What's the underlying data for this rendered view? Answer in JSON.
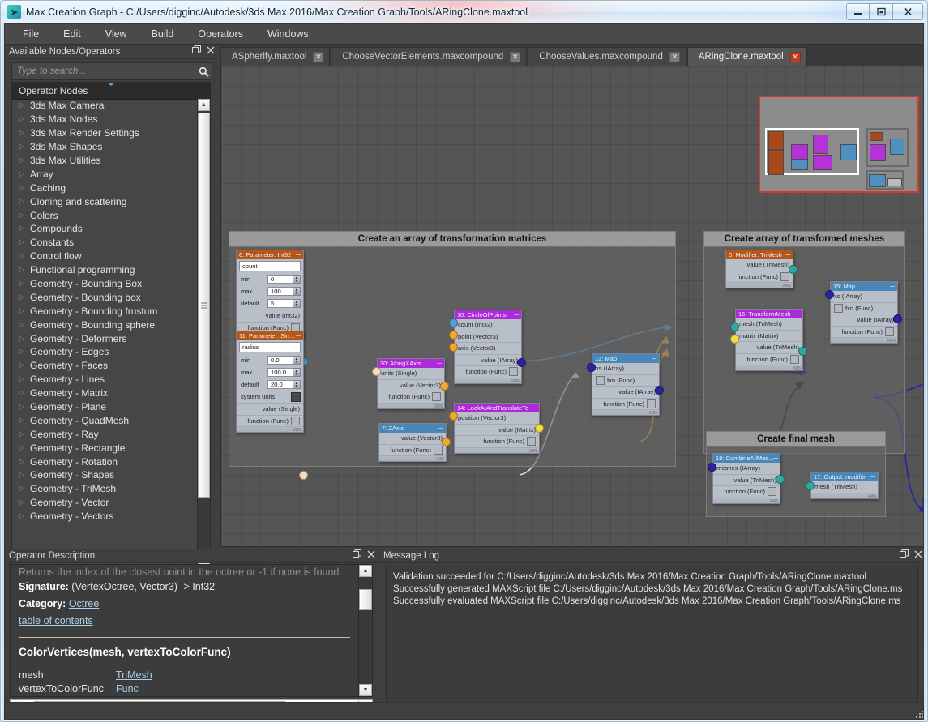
{
  "window": {
    "title": "Max Creation Graph - C:/Users/digginc/Autodesk/3ds Max 2016/Max Creation Graph/Tools/ARingClone.maxtool",
    "icon": "app-icon",
    "buttons": {
      "minimize": "minimize-icon",
      "maximize": "maximize-icon",
      "close": "close-icon"
    }
  },
  "menubar": {
    "items": [
      "File",
      "Edit",
      "View",
      "Build",
      "Operators",
      "Windows"
    ]
  },
  "left_panel": {
    "title": "Available Nodes/Operators",
    "float_icon": "restore-icon",
    "close_icon": "close-icon",
    "search": {
      "placeholder": "Type to search...",
      "value": "",
      "icon": "search-icon"
    },
    "tree_header": "Operator Nodes",
    "items": [
      "3ds Max Camera",
      "3ds Max Nodes",
      "3ds Max Render Settings",
      "3ds Max Shapes",
      "3ds Max Utilities",
      "Array",
      "Caching",
      "Cloning and scattering",
      "Colors",
      "Compounds",
      "Constants",
      "Control flow",
      "Functional programming",
      "Geometry - Bounding Box",
      "Geometry - Bounding box",
      "Geometry - Bounding frustum",
      "Geometry - Bounding sphere",
      "Geometry - Deformers",
      "Geometry - Edges",
      "Geometry - Faces",
      "Geometry - Lines",
      "Geometry - Matrix",
      "Geometry - Plane",
      "Geometry - QuadMesh",
      "Geometry - Ray",
      "Geometry - Rectangle",
      "Geometry - Rotation",
      "Geometry - Shapes",
      "Geometry - TriMesh",
      "Geometry - Vector",
      "Geometry - Vectors"
    ]
  },
  "tabs": [
    {
      "label": "ASpherify.maxtool",
      "active": false
    },
    {
      "label": "ChooseVectorElements.maxcompound",
      "active": false
    },
    {
      "label": "ChooseValues.maxcompound",
      "active": false
    },
    {
      "label": "ARingClone.maxtool",
      "active": true
    }
  ],
  "graph": {
    "groups": [
      {
        "title": "Create an array of transformation matrices"
      },
      {
        "title": "Create array of transformed meshes"
      },
      {
        "title": "Create final mesh"
      }
    ],
    "nodes": [
      {
        "title": "6: Parameter: Int32",
        "color": "orange",
        "field": "count",
        "params": [
          {
            "label": "min",
            "value": "0"
          },
          {
            "label": "max",
            "value": "100"
          },
          {
            "label": "default",
            "value": "5"
          }
        ],
        "rows": [
          "value (Int32)",
          "function (Func)"
        ]
      },
      {
        "title": "11: Parameter: Sin...",
        "color": "orange",
        "field": "radius",
        "params": [
          {
            "label": "min",
            "value": "0.0"
          },
          {
            "label": "max",
            "value": "100.0"
          },
          {
            "label": "default",
            "value": "20.0"
          },
          {
            "label": "system units",
            "value": ""
          }
        ],
        "rows": [
          "value (Single)",
          "function (Func)"
        ]
      },
      {
        "title": "30: AlongXAxis",
        "color": "purple",
        "rows": [
          "units (Single)",
          "value (Vector3)",
          "function (Func)"
        ]
      },
      {
        "title": "7: ZAxis",
        "color": "blue",
        "rows": [
          "value (Vector3)",
          "function (Func)"
        ]
      },
      {
        "title": "10: CircleOfPoints",
        "color": "purple",
        "rows": [
          "count (Int32)",
          "point (Vector3)",
          "axis (Vector3)",
          "value (IArray)",
          "function (Func)"
        ]
      },
      {
        "title": "14: LookAtAndTranslateTo",
        "color": "purple",
        "rows": [
          "position (Vector3)",
          "value (Matrix)",
          "function (Func)"
        ]
      },
      {
        "title": "13: Map",
        "color": "blue",
        "rows": [
          "xs (IArray)",
          "fxn (Func)",
          "value (IArray)",
          "function (Func)"
        ]
      },
      {
        "title": "0: Modifier: TriMesh",
        "color": "orange",
        "rows": [
          "value (TriMesh)",
          "function (Func)"
        ]
      },
      {
        "title": "16: TransformMesh",
        "color": "purple",
        "rows": [
          "mesh (TriMesh)",
          "matrix (Matrix)",
          "value (TriMesh)",
          "function (Func)"
        ]
      },
      {
        "title": "15: Map",
        "color": "blue",
        "rows": [
          "xs (IArray)",
          "fxn (Func)",
          "value (IArray)",
          "function (Func)"
        ]
      },
      {
        "title": "18: CombineAllMes...",
        "color": "blue",
        "rows": [
          "meshes (IArray)",
          "value (TriMesh)",
          "function (Func)"
        ]
      },
      {
        "title": "17: Output: modifier",
        "color": "blue",
        "rows": [
          "mesh (TriMesh)"
        ]
      }
    ],
    "port_colors": {
      "int32": "#5a9fd4",
      "vector3": "#f0a830",
      "single": "#f3dcc0",
      "iarray": "#2a249e",
      "matrix": "#f2dd47",
      "trimesh": "#2fa8a0"
    }
  },
  "operator_description": {
    "title": "Operator Description",
    "float_icon": "restore-icon",
    "close_icon": "close-icon",
    "clipped_line": "Returns the index of the closest point in the octree or -1 if none is found.",
    "signature_label": "Signature:",
    "signature_value": "(VertexOctree, Vector3) -> Int32",
    "category_label": "Category:",
    "category_value": "Octree",
    "toc_link": "table of contents",
    "heading": "ColorVertices(mesh, vertexToColorFunc)",
    "table": [
      {
        "name": "mesh",
        "type": "TriMesh",
        "link": true
      },
      {
        "name": "vertexToColorFunc",
        "type": "Func",
        "link": false
      }
    ]
  },
  "message_log": {
    "title": "Message Log",
    "float_icon": "restore-icon",
    "close_icon": "close-icon",
    "lines": [
      "Validation succeeded for C:/Users/digginc/Autodesk/3ds Max 2016/Max Creation Graph/Tools/ARingClone.maxtool",
      "Successfully generated MAXScript file C:/Users/digginc/Autodesk/3ds Max 2016/Max Creation Graph/Tools/ARingClone.ms",
      "Successfully evaluated MAXScript file C:/Users/digginc/Autodesk/3ds Max 2016/Max Creation Graph/Tools/ARingClone.ms"
    ]
  }
}
